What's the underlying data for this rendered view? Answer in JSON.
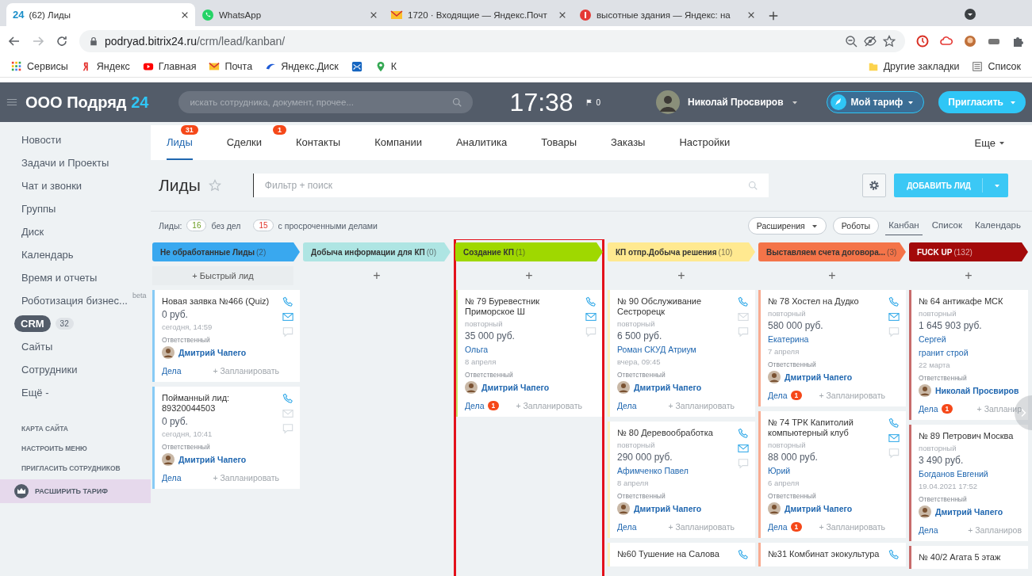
{
  "browser": {
    "tabs": [
      {
        "favicon_text": "24",
        "title": "(62) Лиды",
        "selected": true
      },
      {
        "title": "WhatsApp",
        "selected": false
      },
      {
        "title": "1720 · Входящие — Яндекс.Почт",
        "selected": false
      },
      {
        "title": "высотные здания — Яндекс: на",
        "selected": false
      }
    ],
    "url_host": "podryad.bitrix24.ru",
    "url_path": "/crm/lead/kanban/",
    "bookmarks": [
      "Сервисы",
      "Яндекс",
      "Главная",
      "Почта",
      "Яндекс.Диск",
      "К"
    ],
    "bookmarks_right": [
      "Другие закладки",
      "Список"
    ]
  },
  "header": {
    "company": "ООО Подряд",
    "company_suffix": "24",
    "search_placeholder": "искать сотрудника, документ, прочее...",
    "time": "17:38",
    "flag_count": "0",
    "user": "Николай Просвиров",
    "plan_button": "Мой тариф",
    "invite_button": "Пригласить"
  },
  "sidebar": {
    "items": [
      {
        "label": "Новости",
        "selected": false
      },
      {
        "label": "Задачи и Проекты",
        "selected": false
      },
      {
        "label": "Чат и звонки",
        "selected": false
      },
      {
        "label": "Группы",
        "selected": false
      },
      {
        "label": "Диск",
        "selected": false
      },
      {
        "label": "Календарь",
        "selected": false
      },
      {
        "label": "Время и отчеты",
        "selected": false
      },
      {
        "label": "Роботизация бизнес...",
        "tag": "beta",
        "selected": false
      },
      {
        "label": "CRM",
        "count": "32",
        "selected": true
      },
      {
        "label": "Сайты",
        "selected": false
      },
      {
        "label": "Сотрудники",
        "selected": false
      },
      {
        "label": "Ещё -",
        "selected": false
      }
    ],
    "links": [
      "КАРТА САЙТА",
      "НАСТРОИТЬ МЕНЮ",
      "ПРИГЛАСИТЬ СОТРУДНИКОВ"
    ],
    "upgrade": "РАСШИРИТЬ ТАРИФ"
  },
  "nav": {
    "tabs": [
      {
        "label": "Лиды",
        "badge": "31",
        "selected": true
      },
      {
        "label": "Сделки",
        "badge": "1",
        "selected": false
      },
      {
        "label": "Контакты",
        "selected": false
      },
      {
        "label": "Компании",
        "selected": false
      },
      {
        "label": "Аналитика",
        "selected": false
      },
      {
        "label": "Товары",
        "selected": false
      },
      {
        "label": "Заказы",
        "selected": false
      },
      {
        "label": "Настройки",
        "selected": false
      }
    ],
    "more": "Еще"
  },
  "toolbar": {
    "title": "Лиды",
    "filter_placeholder": "Фильтр + поиск",
    "add_button": "ДОБАВИТЬ ЛИД"
  },
  "counters": {
    "label": "Лиды:",
    "no_tasks_count": "16",
    "no_tasks_label": "без дел",
    "overdue_count": "15",
    "overdue_label": "с просроченными делами",
    "extensions": "Расширения",
    "robots": "Роботы",
    "views": [
      {
        "label": "Канбан",
        "selected": true
      },
      {
        "label": "Список",
        "selected": false
      },
      {
        "label": "Календарь",
        "selected": false
      }
    ]
  },
  "columns": [
    {
      "name": "Не обработанные Лиды",
      "count": "(2)",
      "color": "#39a8ef",
      "add": "+ Быстрый лид",
      "highlighted": false,
      "cards": [
        {
          "kind": "full",
          "title": "Новая заявка №466 (Quiz)",
          "amount": "0 руб.",
          "date": "сегодня, 14:59",
          "resp_label": "Ответственный",
          "responsible": "Дмитрий Чапего",
          "tasks": "Дела",
          "plan": "+ Запланировать",
          "mail_active": true
        },
        {
          "kind": "full",
          "title": "Пойманный лид: 89320044503",
          "amount": "0 руб.",
          "date": "сегодня, 10:41",
          "resp_label": "Ответственный",
          "responsible": "Дмитрий Чапего",
          "tasks": "Дела",
          "plan": "+ Запланировать",
          "mail_active": false
        }
      ]
    },
    {
      "name": "Добыча информации для КП",
      "count": "(0)",
      "color": "#aee5e3",
      "add": "+",
      "highlighted": false
    },
    {
      "name": "Создание КП",
      "count": "(1)",
      "color": "#9fd800",
      "add": "+",
      "highlighted": true,
      "cards": [
        {
          "kind": "full",
          "title": "№ 79 Буревестник Приморское Ш",
          "status": "повторный",
          "amount": "35 000 руб.",
          "contacts": [
            "Ольга"
          ],
          "date": "8 апреля",
          "resp_label": "Ответственный",
          "responsible": "Дмитрий Чапего",
          "tasks": "Дела",
          "tasks_count": "1",
          "plan": "+ Запланировать",
          "mail_active": true
        }
      ]
    },
    {
      "name": "КП отпр.Добыча решения",
      "count": "(10)",
      "color": "#ffe990",
      "add": "+",
      "highlighted": false,
      "cards": [
        {
          "kind": "full",
          "title": "№ 90 Обслуживание Сестрорецк",
          "status": "повторный",
          "amount": "6 500 руб.",
          "contacts": [
            "Роман СКУД Атриум"
          ],
          "date": "вчера, 09:45",
          "resp_label": "Ответственный",
          "responsible": "Дмитрий Чапего",
          "tasks": "Дела",
          "plan": "+ Запланировать",
          "mail_active": false
        },
        {
          "kind": "full",
          "title": "№ 80 Деревообработка",
          "status": "повторный",
          "amount": "290 000 руб.",
          "contacts": [
            "Афимченко Павел"
          ],
          "date": "8 апреля",
          "resp_label": "Ответственный",
          "responsible": "Дмитрий Чапего",
          "tasks": "Дела",
          "plan": "+ Запланировать",
          "mail_active": true
        },
        {
          "kind": "cut",
          "title": "№60 Тушение на Салова"
        }
      ]
    },
    {
      "name": "Выставляем счета договора...",
      "count": "(3)",
      "color": "#f47449",
      "add": "+",
      "highlighted": false,
      "cards": [
        {
          "kind": "full",
          "title": "№ 78 Хостел на Дудко",
          "status": "повторный",
          "amount": "580 000 руб.",
          "contacts": [
            "Екатерина"
          ],
          "date": "7 апреля",
          "resp_label": "Ответственный",
          "responsible": "Дмитрий Чапего",
          "tasks": "Дела",
          "tasks_count": "1",
          "plan": "+ Запланировать",
          "mail_active": true
        },
        {
          "kind": "full",
          "title": "№ 74 ТРК Капитолий компьютерный клуб",
          "status": "повторный",
          "amount": "88 000 руб.",
          "contacts": [
            "Юрий"
          ],
          "date": "6 апреля",
          "resp_label": "Ответственный",
          "responsible": "Дмитрий Чапего",
          "tasks": "Дела",
          "tasks_count": "1",
          "plan": "+ Запланировать",
          "mail_active": true
        },
        {
          "kind": "cut",
          "title": "№31 Комбинат экокультура"
        }
      ]
    },
    {
      "name": "FUCK UP",
      "count": "(132)",
      "color": "#a30a0a",
      "add": "+",
      "highlighted": false,
      "cards": [
        {
          "kind": "full",
          "title": "№ 64 антикафе МСК",
          "status": "повторный",
          "amount": "1 645 903 руб.",
          "contacts": [
            "Сергей",
            "гранит строй"
          ],
          "date": "22 марта",
          "resp_label": "Ответственный",
          "responsible": "Николай Просвиров",
          "tasks": "Дела",
          "tasks_count": "1",
          "plan": "+ Запланир"
        },
        {
          "kind": "full",
          "title": "№ 89 Петрович Москва",
          "status": "повторный",
          "amount": "3 490 руб.",
          "contacts": [
            "Богданов Евгений"
          ],
          "date": "19.04.2021 17:52",
          "resp_label": "Ответственный",
          "responsible": "Дмитрий Чапего",
          "tasks": "Дела",
          "plan": "+ Запланиров"
        },
        {
          "kind": "cut",
          "title": "№ 40/2 Агата 5 этаж"
        }
      ]
    }
  ]
}
